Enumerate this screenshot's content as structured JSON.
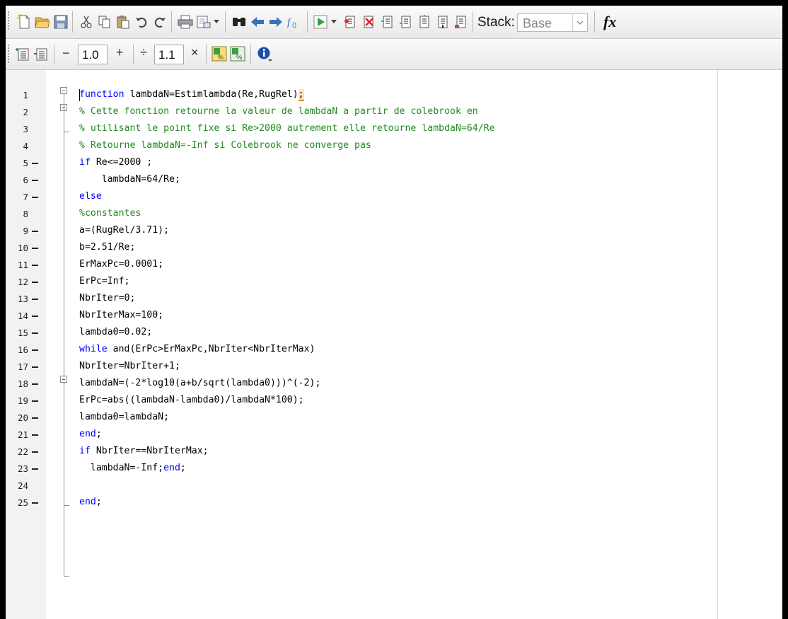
{
  "toolbar": {
    "stack_label": "Stack:",
    "stack_value": "Base",
    "fx_label": "fx",
    "icons": [
      "new-file-icon",
      "open-folder-icon",
      "save-icon",
      "cut-icon",
      "copy-icon",
      "paste-icon",
      "undo-icon",
      "redo-icon",
      "print-icon",
      "print-preview-icon",
      "find-icon",
      "back-arrow-icon",
      "forward-arrow-icon",
      "function-browser-icon",
      "run-icon",
      "insert-breakpoint-icon",
      "clear-breakpoint-icon",
      "step-icon",
      "step-in-icon",
      "step-out-icon",
      "continue-icon",
      "exit-debug-icon",
      "fx-icon"
    ]
  },
  "cell_toolbar": {
    "minus": "−",
    "value1": "1.0",
    "plus": "+",
    "divide": "÷",
    "value2": "1.1",
    "times": "×",
    "icons": [
      "insert-cell-divider-icon",
      "remove-cell-divider-icon",
      "evaluate-cell-icon",
      "evaluate-advance-icon",
      "help-info-icon"
    ]
  },
  "editor": {
    "lines": [
      {
        "n": "1",
        "exec": false,
        "segs": [
          [
            "kw",
            "function"
          ],
          [
            "tx",
            " lambdaN=Estimlambda(Re,RugRel)"
          ],
          [
            "sc",
            ";"
          ]
        ]
      },
      {
        "n": "2",
        "exec": false,
        "segs": [
          [
            "cm",
            "% Cette fonction retourne la valeur de lambdaN a partir de colebrook en"
          ]
        ]
      },
      {
        "n": "3",
        "exec": false,
        "segs": [
          [
            "cm",
            "% utilisant le point fixe si Re>2000 autrement elle retourne lambdaN=64/Re"
          ]
        ]
      },
      {
        "n": "4",
        "exec": false,
        "segs": [
          [
            "cm",
            "% Retourne lambdaN=-Inf si Colebrook ne converge pas"
          ]
        ]
      },
      {
        "n": "5",
        "exec": true,
        "segs": [
          [
            "kw",
            "if"
          ],
          [
            "tx",
            " Re<=2000 ;"
          ]
        ]
      },
      {
        "n": "6",
        "exec": true,
        "segs": [
          [
            "tx",
            "    lambdaN=64/Re;"
          ]
        ]
      },
      {
        "n": "7",
        "exec": true,
        "segs": [
          [
            "kw",
            "else"
          ]
        ]
      },
      {
        "n": "8",
        "exec": false,
        "segs": [
          [
            "cm",
            "%constantes"
          ]
        ]
      },
      {
        "n": "9",
        "exec": true,
        "segs": [
          [
            "tx",
            "a=(RugRel/3.71);"
          ]
        ]
      },
      {
        "n": "10",
        "exec": true,
        "segs": [
          [
            "tx",
            "b=2.51/Re;"
          ]
        ]
      },
      {
        "n": "11",
        "exec": true,
        "segs": [
          [
            "tx",
            "ErMaxPc=0.0001;"
          ]
        ]
      },
      {
        "n": "12",
        "exec": true,
        "segs": [
          [
            "tx",
            "ErPc=Inf;"
          ]
        ]
      },
      {
        "n": "13",
        "exec": true,
        "segs": [
          [
            "tx",
            "NbrIter=0;"
          ]
        ]
      },
      {
        "n": "14",
        "exec": true,
        "segs": [
          [
            "tx",
            "NbrIterMax=100;"
          ]
        ]
      },
      {
        "n": "15",
        "exec": true,
        "segs": [
          [
            "tx",
            "lambda0=0.02;"
          ]
        ]
      },
      {
        "n": "16",
        "exec": true,
        "segs": [
          [
            "kw",
            "while"
          ],
          [
            "tx",
            " and(ErPc>ErMaxPc,NbrIter<NbrIterMax)"
          ]
        ]
      },
      {
        "n": "17",
        "exec": true,
        "segs": [
          [
            "tx",
            "NbrIter=NbrIter+1;"
          ]
        ]
      },
      {
        "n": "18",
        "exec": true,
        "segs": [
          [
            "tx",
            "lambdaN=(-2*log10(a+b/sqrt(lambda0)))^(-2);"
          ]
        ]
      },
      {
        "n": "19",
        "exec": true,
        "segs": [
          [
            "tx",
            "ErPc=abs((lambdaN-lambda0)/lambdaN*100);"
          ]
        ]
      },
      {
        "n": "20",
        "exec": true,
        "segs": [
          [
            "tx",
            "lambda0=lambdaN;"
          ]
        ]
      },
      {
        "n": "21",
        "exec": true,
        "segs": [
          [
            "kw",
            "end"
          ],
          [
            "tx",
            ";"
          ]
        ]
      },
      {
        "n": "22",
        "exec": true,
        "segs": [
          [
            "kw",
            "if"
          ],
          [
            "tx",
            " NbrIter==NbrIterMax;"
          ]
        ]
      },
      {
        "n": "23",
        "exec": true,
        "segs": [
          [
            "tx",
            "  lambdaN=-Inf;"
          ],
          [
            "kw",
            "end"
          ],
          [
            "tx",
            ";"
          ]
        ]
      },
      {
        "n": "24",
        "exec": false,
        "segs": []
      },
      {
        "n": "25",
        "exec": true,
        "segs": [
          [
            "kw",
            "end"
          ],
          [
            "tx",
            ";"
          ]
        ]
      }
    ]
  }
}
